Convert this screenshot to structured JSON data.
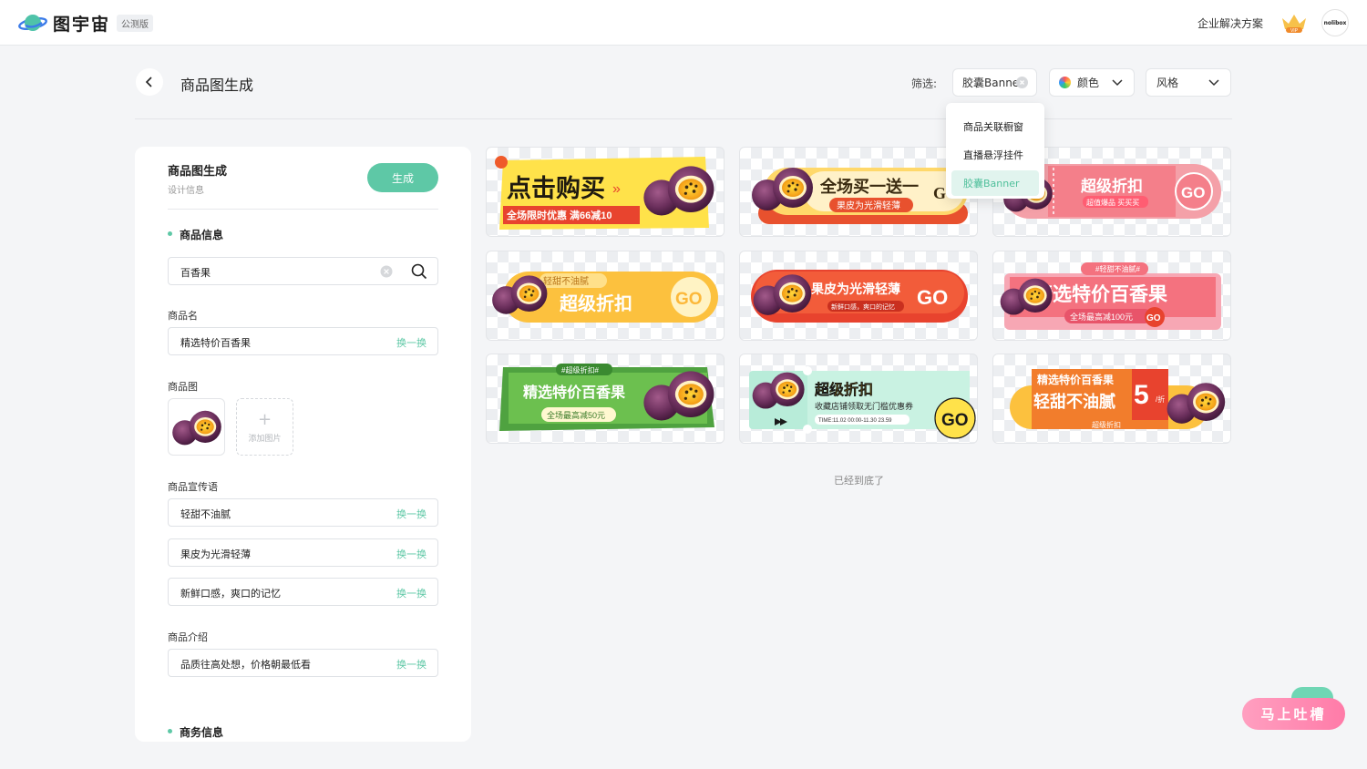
{
  "app": {
    "brand": "图宇宙",
    "beta_badge": "公测版",
    "enterprise": "企业解决方案",
    "avatar_text": "nolibox"
  },
  "header": {
    "title": "商品图生成"
  },
  "filters": {
    "label": "筛选:",
    "type_value": "胶囊Banner",
    "color_label": "颜色",
    "style_label": "风格",
    "type_options": [
      "商品关联橱窗",
      "直播悬浮挂件",
      "胶囊Banner"
    ],
    "selected_index": 2
  },
  "panel": {
    "title": "商品图生成",
    "subtitle": "设计信息",
    "generate": "生成",
    "product_info": "商品信息",
    "search_value": "百香果",
    "name_label": "商品名",
    "name_value": "精选特价百香果",
    "swap": "换一换",
    "image_label": "商品图",
    "add_image": "添加图片",
    "slogan_label": "商品宣传语",
    "slogans": [
      "轻甜不油腻",
      "果皮为光滑轻薄",
      "新鲜口感，爽口的记忆"
    ],
    "intro_label": "商品介绍",
    "intro_value": "品质往高处想，价格朝最低看",
    "business_info": "商务信息"
  },
  "banners": [
    {
      "title": "点击购买",
      "sub": "全场限时优惠 满66减10"
    },
    {
      "title": "全场买一送一",
      "sub": "果皮为光滑轻薄",
      "go": "GO"
    },
    {
      "title": "超级折扣",
      "sub": "超值爆品 买买买",
      "go": "GO"
    },
    {
      "tag": "轻甜不油腻",
      "title": "超级折扣",
      "go": "GO"
    },
    {
      "title": "果皮为光滑轻薄",
      "sub": "新鲜口感，爽口的记忆",
      "go": "GO"
    },
    {
      "tag": "#轻甜不油腻#",
      "title": "精选特价百香果",
      "sub": "全场最高减100元",
      "go": "GO"
    },
    {
      "tag": "#超级折扣#",
      "title": "精选特价百香果",
      "sub": "全场最高减50元"
    },
    {
      "title": "超级折扣",
      "sub": "收藏店铺领取无门槛优惠券",
      "time": "TIME:11.02 00:00-11.30 23.59",
      "go": "GO"
    },
    {
      "title": "精选特价百香果",
      "title2": "轻甜不油腻",
      "big": "5",
      "unit": "/折",
      "sub": "超级折扣"
    }
  ],
  "bottom_note": "已经到底了",
  "feedback": "马上吐槽",
  "colors": {
    "accent": "#5ec8a6",
    "feedback": "#ff86b0"
  }
}
